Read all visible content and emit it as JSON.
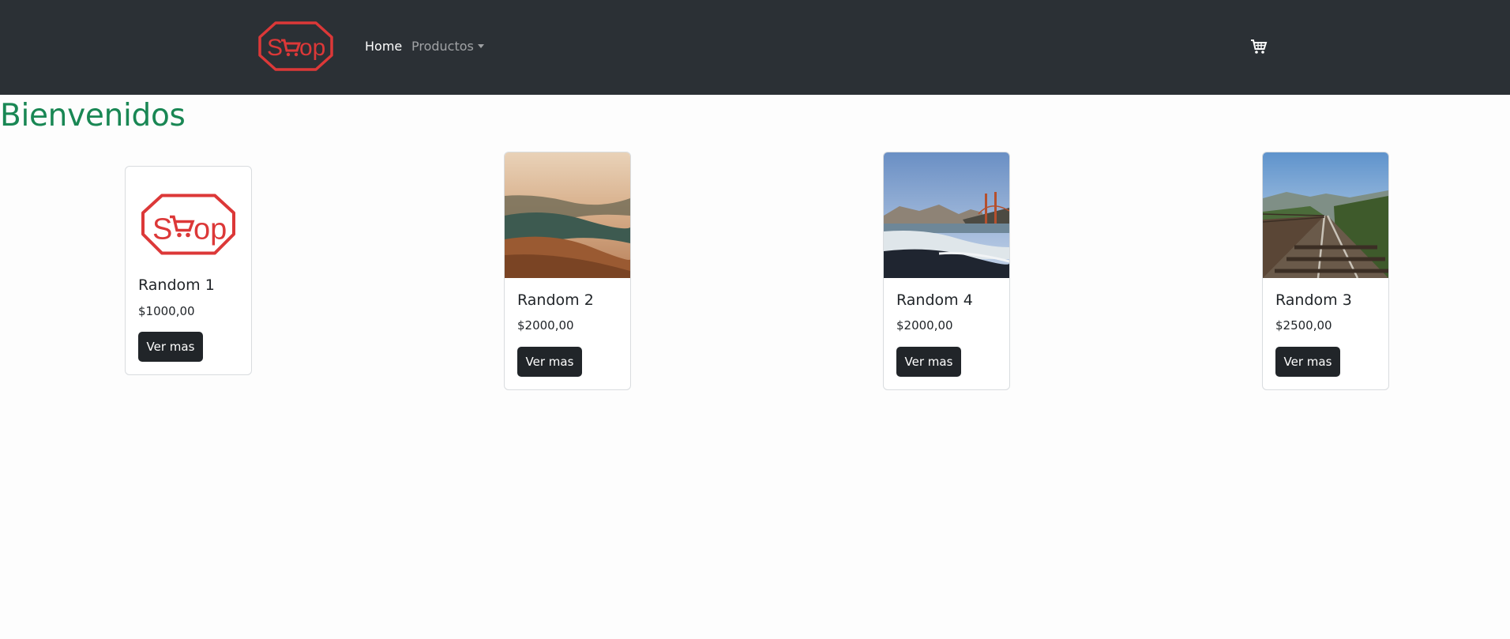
{
  "navbar": {
    "logo_text": "Shop",
    "home_label": "Home",
    "productos_label": "Productos",
    "cart_icon": "cart-icon"
  },
  "page": {
    "title": "Bienvenidos"
  },
  "colors": {
    "navbar_bg": "#2b3035",
    "logo_red": "#dc3838",
    "title_green": "#198754",
    "button_dark": "#212529"
  },
  "products": [
    {
      "name": "Random 1",
      "price": "$1000,00",
      "button": "Ver mas",
      "image": "shop-logo"
    },
    {
      "name": "Random 2",
      "price": "$2000,00",
      "button": "Ver mas",
      "image": "desert-coast-photo"
    },
    {
      "name": "Random 4",
      "price": "$2000,00",
      "button": "Ver mas",
      "image": "golden-gate-beach-photo"
    },
    {
      "name": "Random 3",
      "price": "$2500,00",
      "button": "Ver mas",
      "image": "railway-tracks-photo"
    }
  ]
}
